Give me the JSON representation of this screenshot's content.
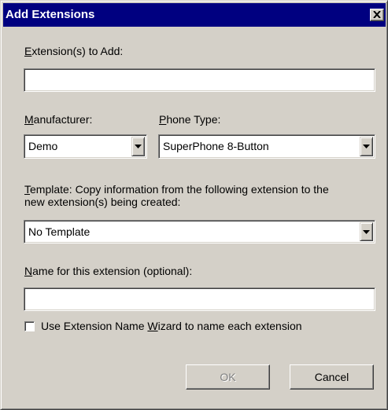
{
  "window": {
    "title": "Add Extensions",
    "close_icon": "close-icon"
  },
  "extensions_to_add": {
    "label_hotkey": "E",
    "label_rest": "xtension(s) to Add:",
    "value": ""
  },
  "manufacturer": {
    "label_hotkey": "M",
    "label_rest": "anufacturer:",
    "selected": "Demo"
  },
  "phone_type": {
    "label_hotkey": "P",
    "label_rest": "hone Type:",
    "selected": "SuperPhone 8-Button"
  },
  "template": {
    "label_hotkey": "T",
    "label_rest": "emplate: Copy information from the following extension to the",
    "label_line2": "new extension(s) being created:",
    "selected": "No Template"
  },
  "name_field": {
    "label_hotkey": "N",
    "label_rest": "ame for this extension (optional):",
    "value": ""
  },
  "wizard_checkbox": {
    "label_before": "Use Extension Name ",
    "label_hotkey": "W",
    "label_after": "izard to name each extension",
    "checked": false
  },
  "buttons": {
    "ok_label": "OK",
    "ok_enabled": false,
    "cancel_label": "Cancel"
  }
}
